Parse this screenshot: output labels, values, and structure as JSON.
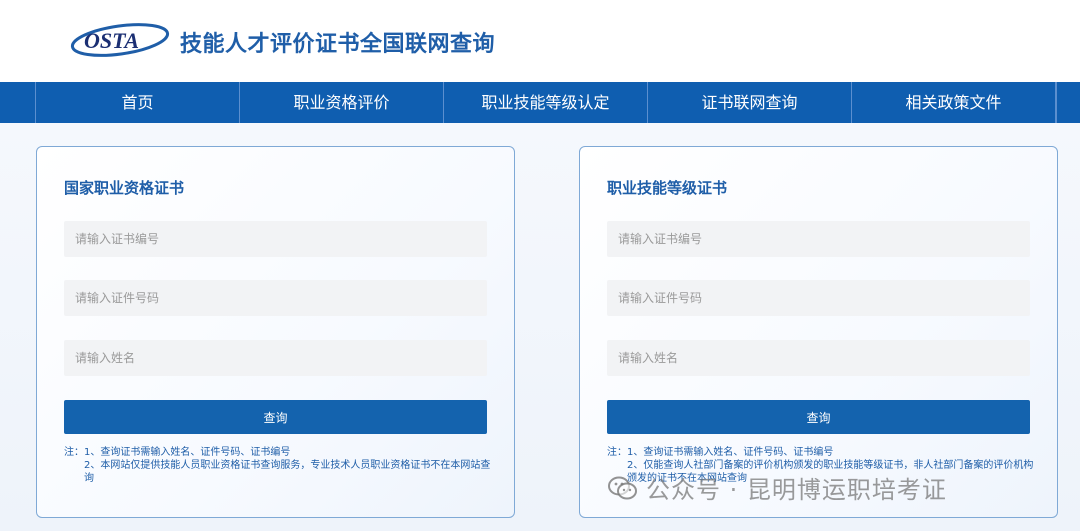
{
  "header": {
    "logo_text": "OSTA",
    "site_title": "技能人才评价证书全国联网查询"
  },
  "nav": {
    "items": [
      {
        "label": "首页"
      },
      {
        "label": "职业资格评价"
      },
      {
        "label": "职业技能等级认定"
      },
      {
        "label": "证书联网查询"
      },
      {
        "label": "相关政策文件"
      }
    ]
  },
  "cards": {
    "left": {
      "title": "国家职业资格证书",
      "cert_no_placeholder": "请输入证书编号",
      "id_no_placeholder": "请输入证件号码",
      "name_placeholder": "请输入姓名",
      "button_label": "查询",
      "note_1": "注：1、查询证书需输入姓名、证件号码、证书编号",
      "note_2": "2、本网站仅提供技能人员职业资格证书查询服务，专业技术人员职业资格证书不在本网站查询"
    },
    "right": {
      "title": "职业技能等级证书",
      "cert_no_placeholder": "请输入证书编号",
      "id_no_placeholder": "请输入证件号码",
      "name_placeholder": "请输入姓名",
      "button_label": "查询",
      "note_1": "注：1、查询证书需输入姓名、证件号码、证书编号",
      "note_2": "2、仅能查询人社部门备案的评价机构颁发的职业技能等级证书，非人社部门备案的评价机构颁发的证书不在本网站查询"
    }
  },
  "watermark": {
    "text": "公众号 · 昆明博运职培考证"
  },
  "colors": {
    "brand_blue": "#1f5ea8",
    "nav_blue": "#0f5eb0",
    "button_blue": "#1463ae",
    "card_border": "#7fa9d6"
  }
}
